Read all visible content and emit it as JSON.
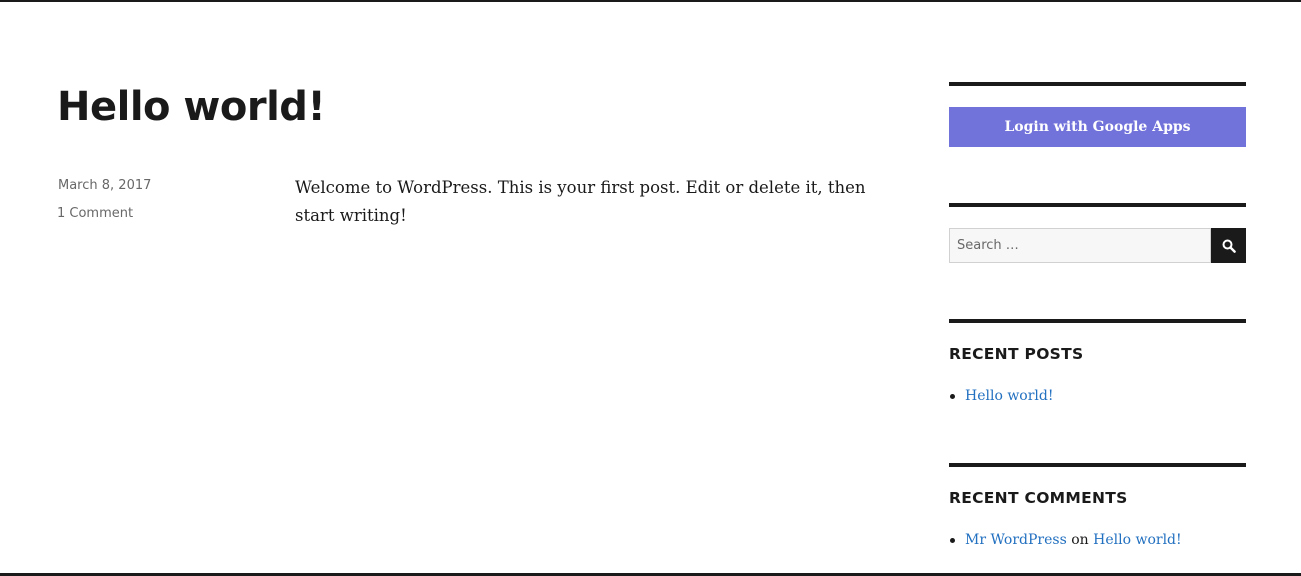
{
  "post": {
    "title": "Hello world!",
    "date": "March 8, 2017",
    "comments": "1 Comment",
    "content": "Welcome to WordPress. This is your first post. Edit or delete it, then start writing!"
  },
  "sidebar": {
    "login_button": "Login with Google Apps",
    "search": {
      "placeholder": "Search …",
      "button_icon": "search-icon"
    },
    "recent_posts": {
      "title": "RECENT POSTS",
      "items": [
        "Hello world!"
      ]
    },
    "recent_comments": {
      "title": "RECENT COMMENTS",
      "items": [
        {
          "author": "Mr WordPress",
          "connector": "on",
          "post": "Hello world!"
        }
      ]
    }
  },
  "colors": {
    "accent": "#7272db",
    "link": "#2270c0",
    "text": "#1a1a1a",
    "muted": "#686868"
  }
}
